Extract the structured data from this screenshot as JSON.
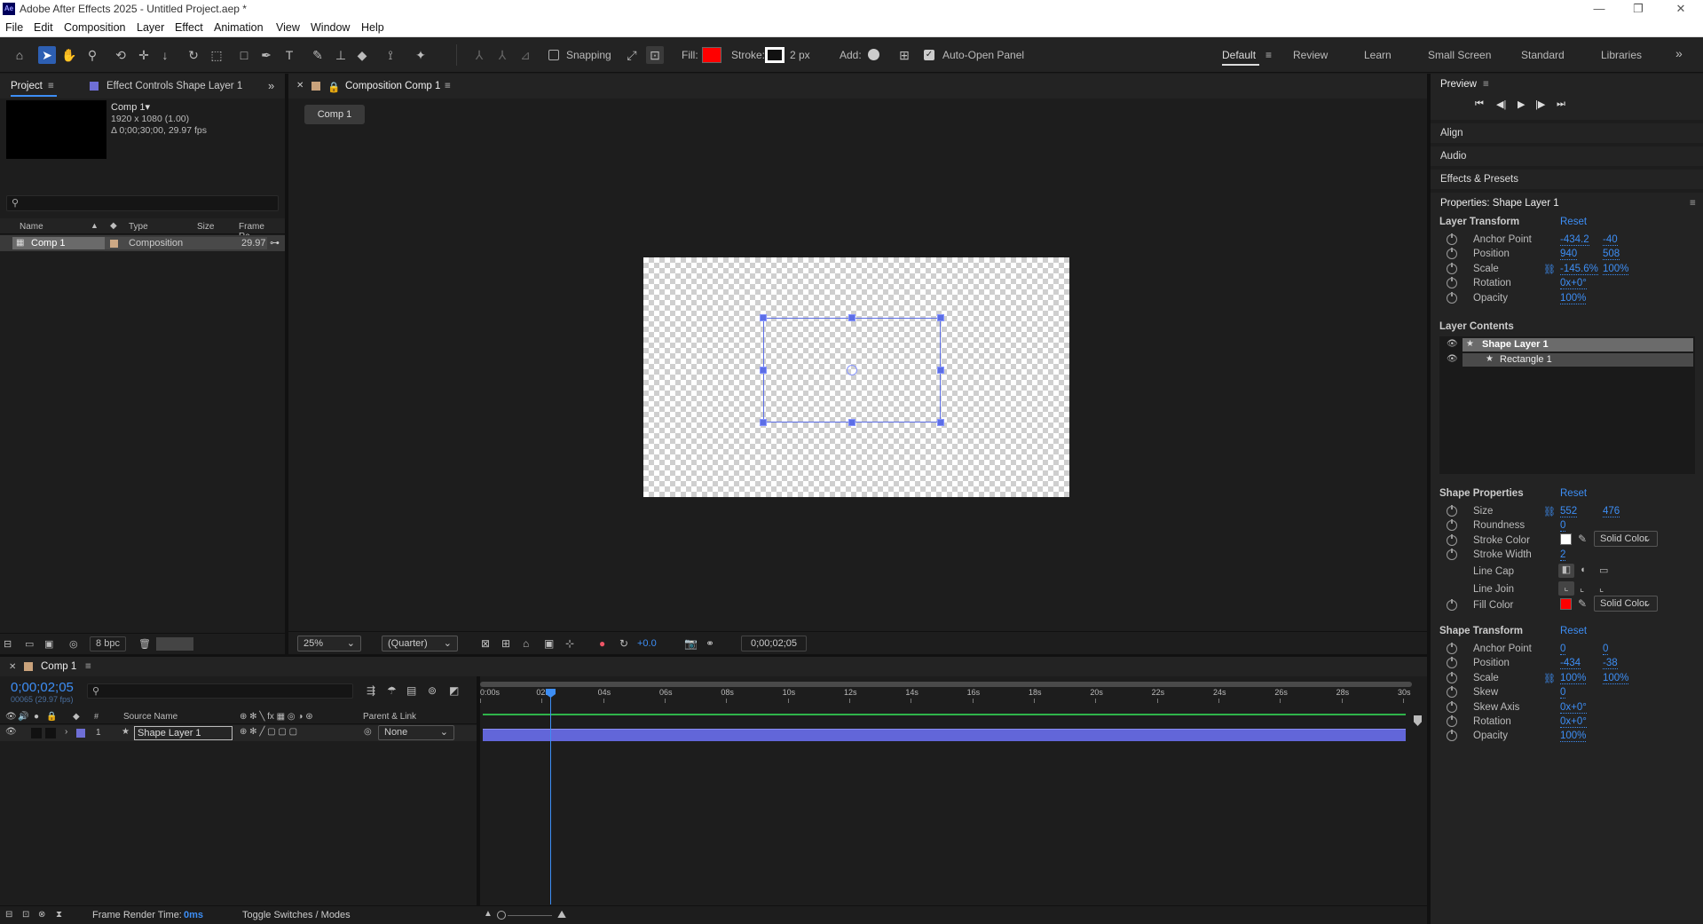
{
  "window": {
    "logo": "Ae",
    "title": "Adobe After Effects 2025 - Untitled Project.aep *",
    "controls": [
      "—",
      "❐",
      "✕"
    ]
  },
  "menu": [
    "File",
    "Edit",
    "Composition",
    "Layer",
    "Effect",
    "Animation",
    "View",
    "Window",
    "Help"
  ],
  "toolbar": {
    "snapping": "Snapping",
    "fill_label": "Fill:",
    "fill_color": "#ff0000",
    "stroke_label": "Stroke:",
    "stroke_width": "2 px",
    "add_label": "Add:",
    "auto_open": "Auto-Open Panel",
    "workspaces": [
      "Default",
      "Review",
      "Learn",
      "Small Screen",
      "Standard",
      "Libraries"
    ],
    "more": "»"
  },
  "project": {
    "tab": "Project",
    "effect_tab": "Effect Controls Shape Layer 1",
    "expand": "»",
    "comp_name": "Comp 1▾",
    "comp_res": "1920 x 1080 (1.00)",
    "comp_dur": "Δ 0;00;30;00, 29.97 fps",
    "columns": [
      "Name",
      "Type",
      "Size",
      "Frame Ra..."
    ],
    "row": {
      "name": "Comp 1",
      "type": "Composition",
      "fps": "29.97"
    },
    "bpc": "8 bpc"
  },
  "composition": {
    "tab": "Composition Comp 1",
    "crumb": "Comp 1",
    "zoom": "25%",
    "quality": "(Quarter)",
    "exposure": "+0.0",
    "timecode": "0;00;02;05"
  },
  "timeline": {
    "tab": "Comp 1",
    "timecode": "0;00;02;05",
    "frames": "00065 (29.97 fps)",
    "col_source": "Source Name",
    "col_parent": "Parent & Link",
    "col_num": "#",
    "layer": {
      "num": "1",
      "name": "Shape Layer 1",
      "parent": "None"
    },
    "ruler": [
      "0:00s",
      "02s",
      "04s",
      "06s",
      "08s",
      "10s",
      "12s",
      "14s",
      "16s",
      "18s",
      "20s",
      "22s",
      "24s",
      "26s",
      "28s",
      "30s"
    ],
    "render_time_label": "Frame Render Time:",
    "render_time": "0ms",
    "toggle": "Toggle Switches / Modes"
  },
  "right": {
    "preview": "Preview",
    "align": "Align",
    "audio": "Audio",
    "effects": "Effects & Presets",
    "properties_title": "Properties: Shape Layer 1",
    "reset": "Reset",
    "layer_transform": "Layer Transform",
    "lt": [
      {
        "label": "Anchor Point",
        "v1": "-434.2",
        "v2": "-40"
      },
      {
        "label": "Position",
        "v1": "940",
        "v2": "508"
      },
      {
        "label": "Scale",
        "v1": "-145.6%",
        "v2": "100%"
      },
      {
        "label": "Rotation",
        "v1": "0x+0°",
        "v2": ""
      },
      {
        "label": "Opacity",
        "v1": "100%",
        "v2": ""
      }
    ],
    "layer_contents": "Layer Contents",
    "contents": [
      "Shape Layer 1",
      "Rectangle 1"
    ],
    "shape_properties": "Shape Properties",
    "sp": [
      {
        "label": "Size",
        "v1": "552",
        "v2": "476"
      },
      {
        "label": "Roundness",
        "v1": "0",
        "v2": ""
      },
      {
        "label": "Stroke Color",
        "v1": "",
        "v2": ""
      },
      {
        "label": "Stroke Width",
        "v1": "2",
        "v2": ""
      },
      {
        "label": "Line Cap",
        "v1": "",
        "v2": ""
      },
      {
        "label": "Line Join",
        "v1": "",
        "v2": ""
      },
      {
        "label": "Fill Color",
        "v1": "",
        "v2": ""
      }
    ],
    "solid_color": "Solid Color",
    "stroke_color": "#ffffff",
    "fill_color": "#ff0000",
    "shape_transform": "Shape Transform",
    "st": [
      {
        "label": "Anchor Point",
        "v1": "0",
        "v2": "0"
      },
      {
        "label": "Position",
        "v1": "-434",
        "v2": "-38"
      },
      {
        "label": "Scale",
        "v1": "100%",
        "v2": "100%"
      },
      {
        "label": "Skew",
        "v1": "0",
        "v2": ""
      },
      {
        "label": "Skew Axis",
        "v1": "0x+0°",
        "v2": ""
      },
      {
        "label": "Rotation",
        "v1": "0x+0°",
        "v2": ""
      },
      {
        "label": "Opacity",
        "v1": "100%",
        "v2": ""
      }
    ]
  }
}
